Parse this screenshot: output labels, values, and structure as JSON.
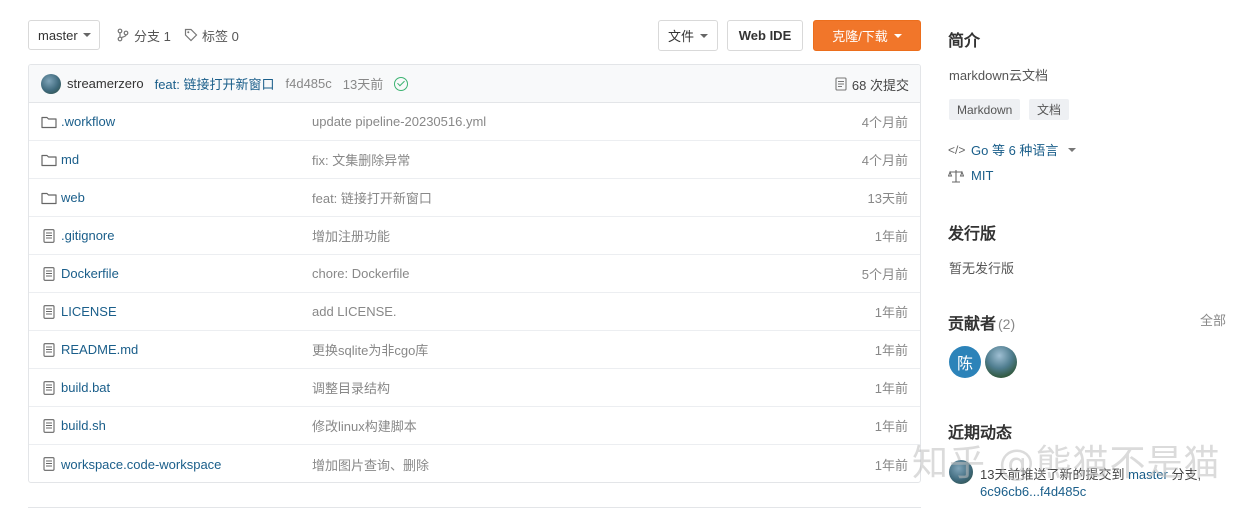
{
  "toolbar": {
    "branch": "master",
    "branches_label": "分支 1",
    "tags_label": "标签 0",
    "files_button": "文件",
    "webide_button": "Web IDE",
    "clone_button": "克隆/下载",
    "clone_color": "#f1762a"
  },
  "last_commit": {
    "author": "streamerzero",
    "message": "feat: 链接打开新窗口",
    "sha": "f4d485c",
    "time": "13天前",
    "status": "check-icon",
    "count_label": "68 次提交"
  },
  "files": [
    {
      "type": "folder",
      "name": ".workflow",
      "commit": "update pipeline-20230516.yml",
      "time": "4个月前"
    },
    {
      "type": "folder",
      "name": "md",
      "commit": "fix: 文集删除异常",
      "time": "4个月前"
    },
    {
      "type": "folder",
      "name": "web",
      "commit": "feat: 链接打开新窗口",
      "time": "13天前"
    },
    {
      "type": "file",
      "name": ".gitignore",
      "commit": "增加注册功能",
      "time": "1年前"
    },
    {
      "type": "file",
      "name": "Dockerfile",
      "commit": "chore: Dockerfile",
      "time": "5个月前"
    },
    {
      "type": "file",
      "name": "LICENSE",
      "commit": "add LICENSE.",
      "time": "1年前"
    },
    {
      "type": "file",
      "name": "README.md",
      "commit": "更换sqlite为非cgo库",
      "time": "1年前"
    },
    {
      "type": "file",
      "name": "build.bat",
      "commit": "调整目录结构",
      "time": "1年前"
    },
    {
      "type": "file",
      "name": "build.sh",
      "commit": "修改linux构建脚本",
      "time": "1年前"
    },
    {
      "type": "file",
      "name": "workspace.code-workspace",
      "commit": "增加图片查询、删除",
      "time": "1年前"
    }
  ],
  "sidebar": {
    "intro_title": "简介",
    "description": "markdown云文档",
    "tags": [
      "Markdown",
      "文档"
    ],
    "languages": "Go 等 6 种语言",
    "license": "MIT",
    "releases_title": "发行版",
    "releases_empty": "暂无发行版",
    "contributors_title": "贡献者",
    "contributors_count": "(2)",
    "contributors_all": "全部",
    "contributor_initial": "陈",
    "activity_title": "近期动态",
    "activity_prefix": "13天前推送了新的提交到",
    "activity_branch": "master",
    "activity_suffix": "分支,",
    "activity_range": "6c96cb6...f4d485c"
  },
  "watermark": "知乎 @熊猫不是猫"
}
